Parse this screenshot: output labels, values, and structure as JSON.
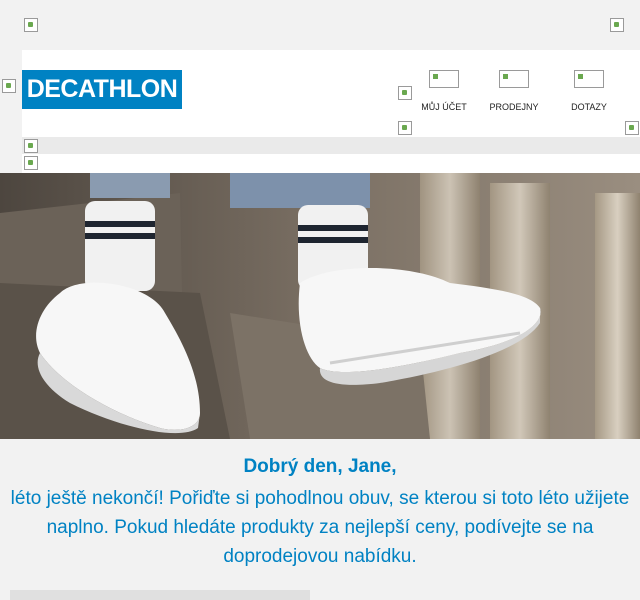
{
  "brand": {
    "name": "DECATHLON",
    "color": "#0082c3"
  },
  "nav": [
    {
      "label": "MŮJ ÚČET",
      "icon": "user-icon"
    },
    {
      "label": "PRODEJNY",
      "icon": "store-icon"
    },
    {
      "label": "DOTAZY",
      "icon": "question-icon"
    }
  ],
  "hero": {
    "icon": "hero-image-sneakers"
  },
  "greeting": {
    "title": "Dobrý den, Jane,",
    "body": "léto ještě nekončí! Pořiďte si pohodlnou obuv, se kterou si toto léto užijete naplno. Pokud hledáte produkty za nejlepší ceny, podívejte se na doprodejovou nabídku."
  }
}
